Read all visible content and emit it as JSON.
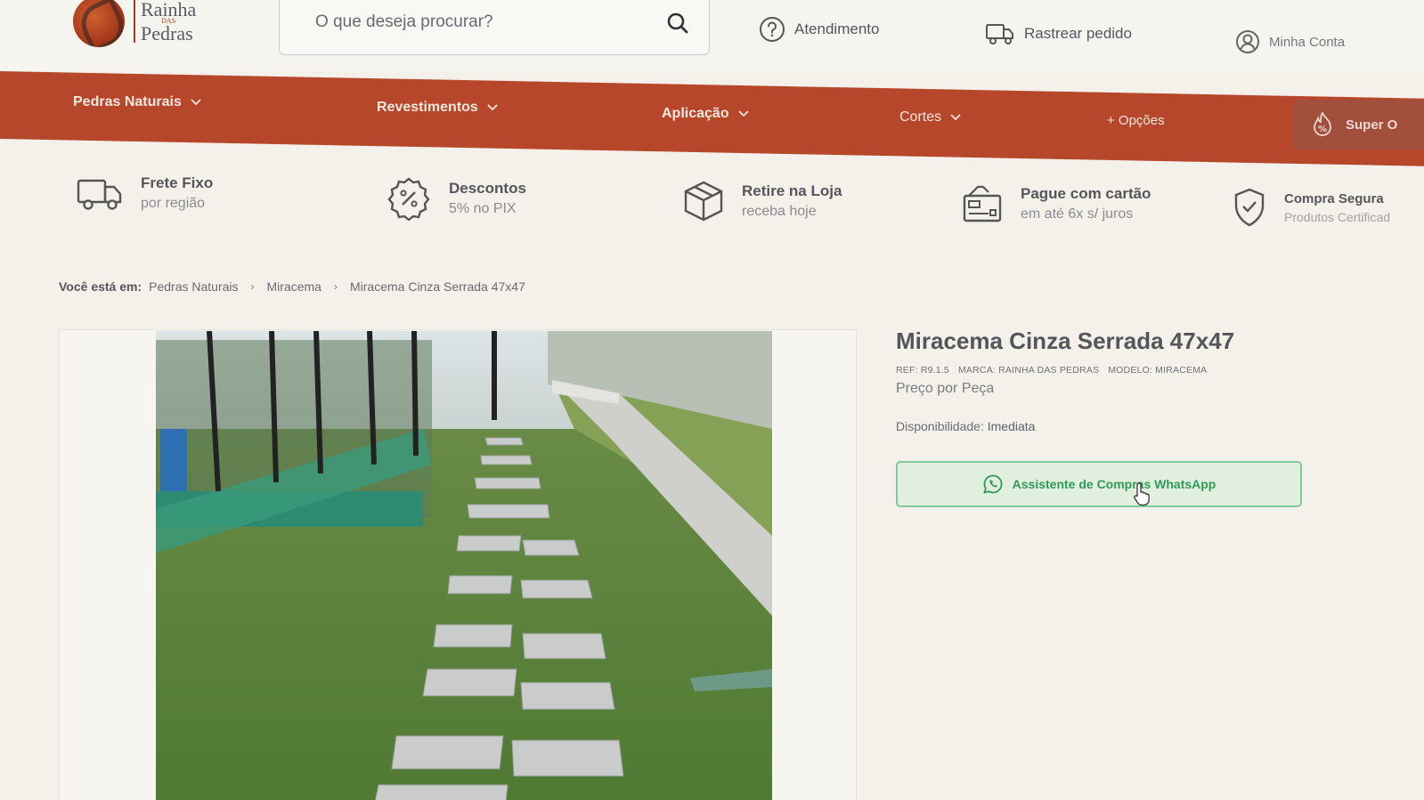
{
  "header": {
    "logo": {
      "line1": "Rainha",
      "das": "DAS",
      "line2": "Pedras"
    },
    "search": {
      "placeholder": "O que deseja procurar?"
    },
    "links": {
      "support": "Atendimento",
      "track_order": "Rastrear pedido",
      "account": "Minha Conta"
    }
  },
  "nav": {
    "items": [
      "Pedras Naturais",
      "Revestimentos",
      "Aplicação",
      "Cortes",
      "+ Opções"
    ],
    "super_offer": "Super O"
  },
  "features": [
    {
      "title": "Frete Fixo",
      "subtitle": "por região",
      "icon": "truck-icon"
    },
    {
      "title": "Descontos",
      "subtitle": "5% no PIX",
      "icon": "percent-icon"
    },
    {
      "title": "Retire na Loja",
      "subtitle": "receba hoje",
      "icon": "box-icon"
    },
    {
      "title": "Pague com cartão",
      "subtitle": "em até 6x s/ juros",
      "icon": "card-icon"
    },
    {
      "title": "Compra Segura",
      "subtitle": "Produtos Certificad",
      "icon": "shield-icon"
    }
  ],
  "breadcrumb": {
    "label": "Você está em:",
    "items": [
      "Pedras Naturais",
      "Miracema",
      "Miracema Cinza Serrada 47x47"
    ]
  },
  "product": {
    "title": "Miracema Cinza Serrada 47x47",
    "ref": "REF: R9.1.5",
    "brand": "MARCA: RAINHA DAS PEDRAS",
    "model": "MODELO: MIRACEMA",
    "unit": "Preço por Peça",
    "availability_label": "Disponibilidade:",
    "availability_value": "Imediata",
    "whatsapp_button": "Assistente de Compras WhatsApp"
  },
  "colors": {
    "brand_red": "#b6472b",
    "whatsapp_green": "#2f9b57",
    "background": "#f3f1ea"
  }
}
